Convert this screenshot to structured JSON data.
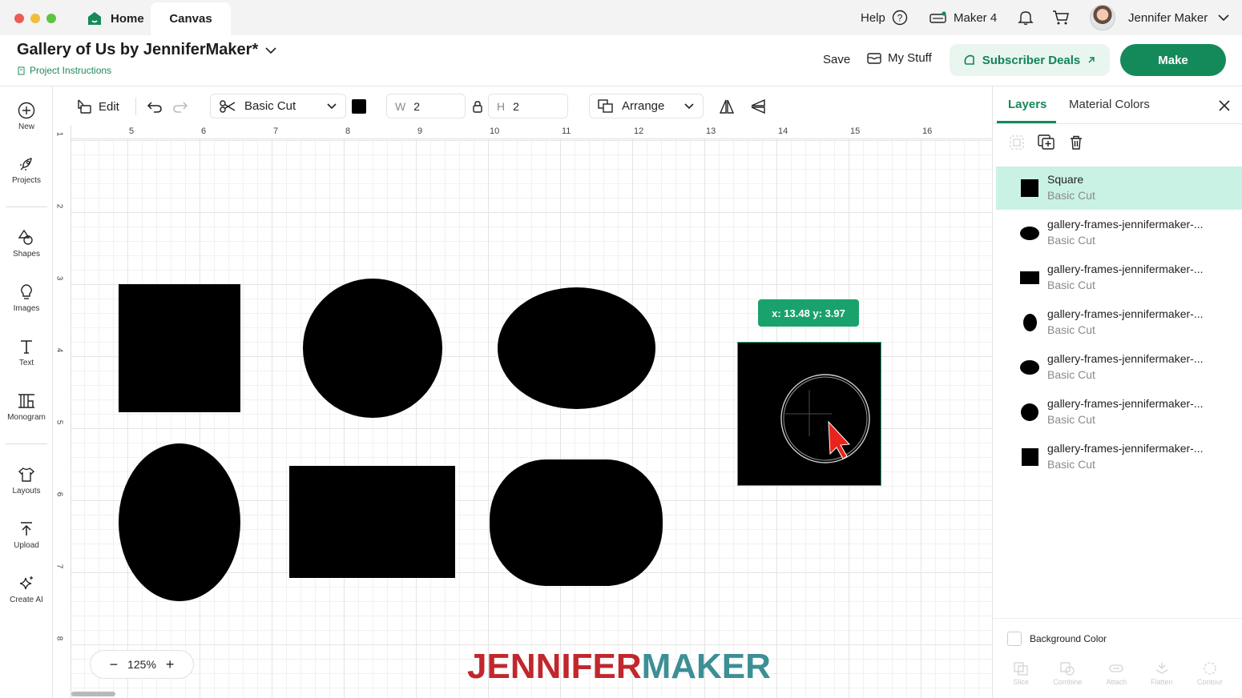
{
  "tabs": {
    "home": "Home",
    "canvas": "Canvas"
  },
  "titlebar": {
    "help": "Help",
    "machine": "Maker 4",
    "user": "Jennifer Maker"
  },
  "project": {
    "title": "Gallery of Us by JenniferMaker*",
    "instructions": "Project Instructions"
  },
  "actions": {
    "save": "Save",
    "my_stuff": "My Stuff",
    "deals": "Subscriber Deals",
    "make": "Make"
  },
  "sidebar": {
    "items": [
      {
        "label": "New",
        "icon": "plus-circle-icon"
      },
      {
        "label": "Projects",
        "icon": "rocket-icon"
      },
      {
        "label": "Shapes",
        "icon": "shapes-icon"
      },
      {
        "label": "Images",
        "icon": "lightbulb-icon"
      },
      {
        "label": "Text",
        "icon": "text-icon"
      },
      {
        "label": "Monogram",
        "icon": "monogram-icon"
      },
      {
        "label": "Layouts",
        "icon": "shirt-icon"
      },
      {
        "label": "Upload",
        "icon": "upload-icon"
      },
      {
        "label": "Create AI",
        "icon": "sparkle-icon"
      }
    ]
  },
  "toolbar": {
    "edit": "Edit",
    "operation": "Basic Cut",
    "color": "#000000",
    "w_label": "W",
    "w_value": "2",
    "h_label": "H",
    "h_value": "2",
    "arrange": "Arrange"
  },
  "ruler": {
    "top": [
      "5",
      "6",
      "7",
      "8",
      "9",
      "10",
      "11",
      "12",
      "13",
      "14",
      "15",
      "16"
    ],
    "left": [
      "1",
      "2",
      "3",
      "4",
      "5",
      "6",
      "7",
      "8"
    ]
  },
  "canvas": {
    "coord_tip": "x: 13.48 y: 3.97",
    "zoom": "125%",
    "brand_part1": "JENNIFER",
    "brand_part2": "MAKER"
  },
  "panel": {
    "tab_layers": "Layers",
    "tab_material": "Material Colors",
    "layers": [
      {
        "name": "Square",
        "op": "Basic Cut",
        "shape": "square",
        "selected": true
      },
      {
        "name": "gallery-frames-jennifermaker-...",
        "op": "Basic Cut",
        "shape": "wide-oval"
      },
      {
        "name": "gallery-frames-jennifermaker-...",
        "op": "Basic Cut",
        "shape": "rectangle"
      },
      {
        "name": "gallery-frames-jennifermaker-...",
        "op": "Basic Cut",
        "shape": "tall-oval"
      },
      {
        "name": "gallery-frames-jennifermaker-...",
        "op": "Basic Cut",
        "shape": "oval"
      },
      {
        "name": "gallery-frames-jennifermaker-...",
        "op": "Basic Cut",
        "shape": "circle"
      },
      {
        "name": "gallery-frames-jennifermaker-...",
        "op": "Basic Cut",
        "shape": "square"
      }
    ],
    "background_color": "Background Color",
    "bottom_tools": [
      "Slice",
      "Combine",
      "Attach",
      "Flatten",
      "Contour"
    ]
  },
  "colors": {
    "accent": "#148a5a",
    "selection": "#c9f2e4",
    "tip": "#1aa26c"
  }
}
